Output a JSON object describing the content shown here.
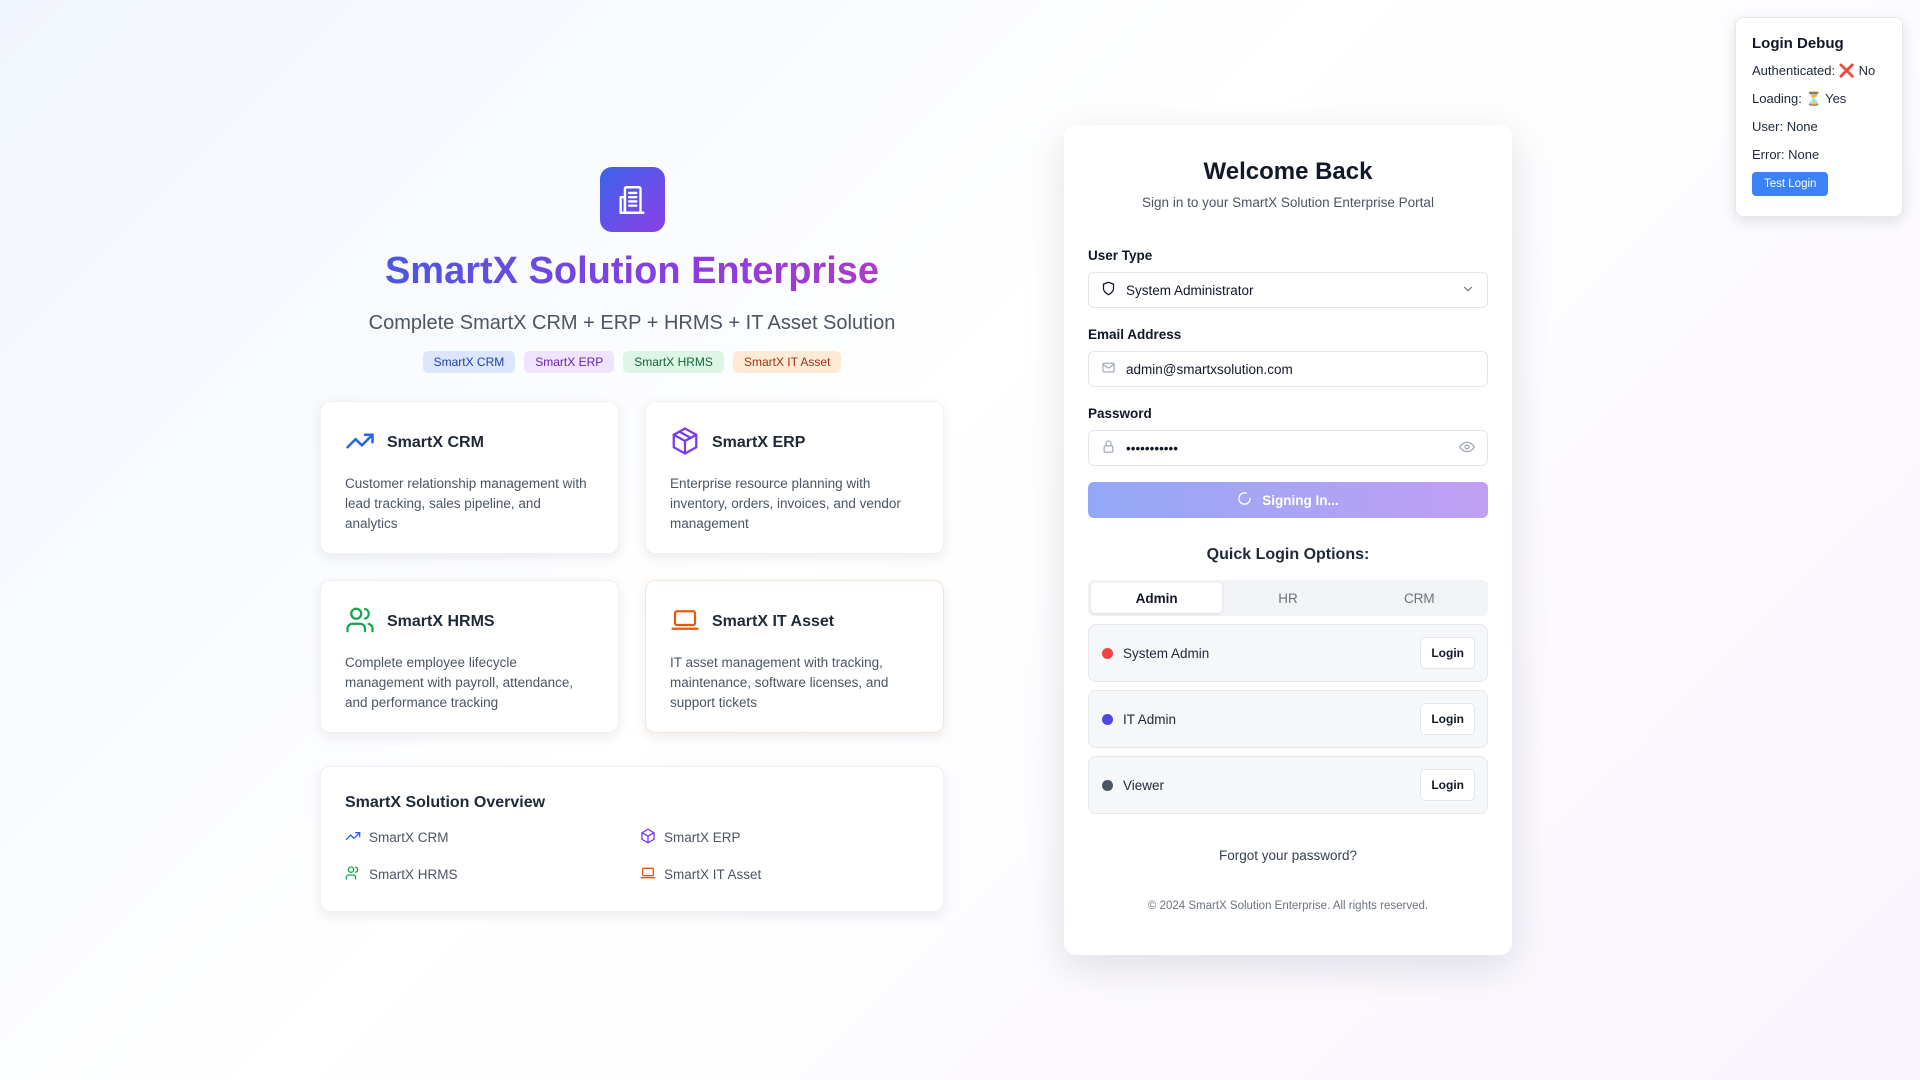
{
  "hero": {
    "title": "SmartX Solution Enterprise",
    "subtitle": "Complete SmartX CRM + ERP + HRMS + IT Asset Solution",
    "logo_icon": "building-icon",
    "tags": [
      "SmartX CRM",
      "SmartX ERP",
      "SmartX HRMS",
      "SmartX IT Asset"
    ]
  },
  "modules": [
    {
      "title": "SmartX CRM",
      "icon": "trending-up-icon",
      "color": "#2563eb",
      "description": "Customer relationship management with lead tracking, sales pipeline, and analytics"
    },
    {
      "title": "SmartX ERP",
      "icon": "package-icon",
      "color": "#7c3aed",
      "description": "Enterprise resource planning with inventory, orders, invoices, and vendor management"
    },
    {
      "title": "SmartX HRMS",
      "icon": "users-icon",
      "color": "#16a34a",
      "description": "Complete employee lifecycle management with payroll, attendance, and performance tracking"
    },
    {
      "title": "SmartX IT Asset",
      "icon": "laptop-icon",
      "color": "#ea580c",
      "description": "IT asset management with tracking, maintenance, software licenses, and support tickets"
    }
  ],
  "overview": {
    "title": "SmartX Solution Overview",
    "items": [
      "SmartX CRM",
      "SmartX ERP",
      "SmartX HRMS",
      "SmartX IT Asset"
    ]
  },
  "login": {
    "title": "Welcome Back",
    "subtitle": "Sign in to your SmartX Solution Enterprise Portal",
    "user_type_label": "User Type",
    "user_type_value": "System Administrator",
    "email_label": "Email Address",
    "email_value": "admin@smartxsolution.com",
    "password_label": "Password",
    "password_value": "•••••••••••",
    "signin_label": "Signing In...",
    "quick_title": "Quick Login Options:",
    "tabs": [
      "Admin",
      "HR",
      "CRM"
    ],
    "active_tab": "Admin",
    "quick_users": [
      {
        "name": "System Admin",
        "color": "#ef4444",
        "button": "Login"
      },
      {
        "name": "IT Admin",
        "color": "#4f46e5",
        "button": "Login"
      },
      {
        "name": "Viewer",
        "color": "#4b5563",
        "button": "Login"
      }
    ],
    "forgot": "Forgot your password?",
    "copyright": "© 2024 SmartX Solution Enterprise. All rights reserved."
  },
  "debug": {
    "title": "Login Debug",
    "authenticated_label": "Authenticated:",
    "authenticated_icon": "❌",
    "authenticated_value": "No",
    "loading_label": "Loading:",
    "loading_icon": "⏳",
    "loading_value": "Yes",
    "user_label": "User:",
    "user_value": "None",
    "error_label": "Error:",
    "error_value": "None",
    "button": "Test Login"
  }
}
